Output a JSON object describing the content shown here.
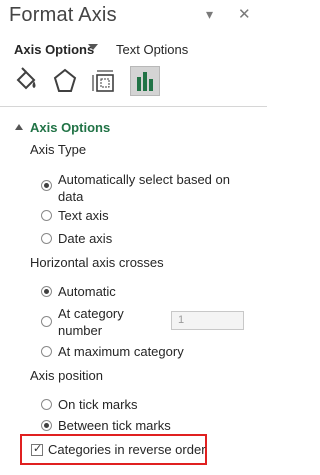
{
  "pane": {
    "title": "Format Axis",
    "dropdown_icon": "chevron-down-icon",
    "close_icon": "close-icon"
  },
  "tabs": {
    "axis_options": "Axis Options",
    "text_options": "Text Options"
  },
  "icons": [
    "fill-line-icon",
    "effects-icon",
    "size-properties-icon",
    "axis-options-icon"
  ],
  "section": {
    "title": "Axis Options",
    "axis_type": {
      "label": "Axis Type",
      "options": [
        {
          "label_line1": "Automatically select based on",
          "label_line2": "data",
          "selected": true
        },
        {
          "label": "Text axis",
          "selected": false
        },
        {
          "label": "Date axis",
          "selected": false
        }
      ]
    },
    "horizontal_crosses": {
      "label": "Horizontal axis crosses",
      "options": [
        {
          "label": "Automatic",
          "selected": true
        },
        {
          "label_line1": "At category",
          "label_line2": "number",
          "selected": false,
          "value": "1"
        },
        {
          "label": "At maximum category",
          "selected": false
        }
      ]
    },
    "axis_position": {
      "label": "Axis position",
      "options": [
        {
          "label": "On tick marks",
          "selected": false
        },
        {
          "label": "Between tick marks",
          "selected": true
        }
      ]
    },
    "reverse_order": {
      "label": "Categories in reverse order",
      "checked": true
    }
  },
  "colors": {
    "accent_green": "#217346",
    "highlight_red": "#e02020"
  }
}
